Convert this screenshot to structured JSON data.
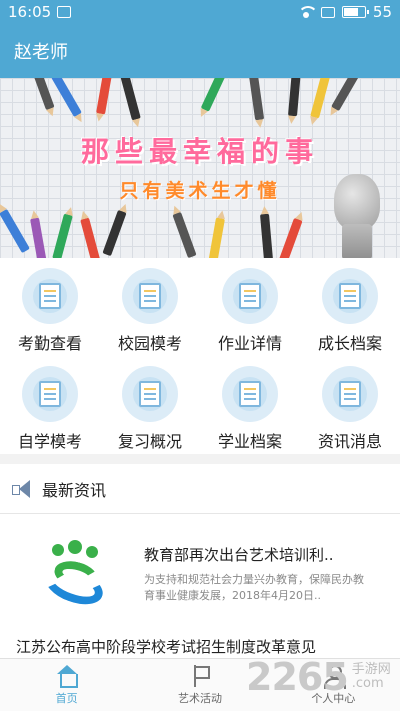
{
  "status_bar": {
    "time": "16:05",
    "battery": "55"
  },
  "header": {
    "title": "赵老师"
  },
  "banner": {
    "title": "那些最幸福的事",
    "subtitle": "只有美术生才懂"
  },
  "grid": [
    {
      "label": "考勤查看",
      "icon": "attendance-calendar-icon"
    },
    {
      "label": "校园模考",
      "icon": "campus-exam-icon"
    },
    {
      "label": "作业详情",
      "icon": "homework-book-icon"
    },
    {
      "label": "成长档案",
      "icon": "growth-archive-icon"
    },
    {
      "label": "自学模考",
      "icon": "self-study-icon"
    },
    {
      "label": "复习概况",
      "icon": "review-icon"
    },
    {
      "label": "学业档案",
      "icon": "academic-folder-icon"
    },
    {
      "label": "资讯消息",
      "icon": "news-message-icon"
    }
  ],
  "news": {
    "header": "最新资讯",
    "items": [
      {
        "title": "教育部再次出台艺术培训利..",
        "summary": "为支持和规范社会力量兴办教育，保障民办教育事业健康发展，2018年4月20日.."
      },
      {
        "title": "江苏公布高中阶段学校考试招生制度改革意见"
      }
    ]
  },
  "bottom_nav": [
    {
      "label": "首页",
      "active": true
    },
    {
      "label": "艺术活动",
      "active": false
    },
    {
      "label": "个人中心",
      "active": false
    }
  ],
  "watermark": {
    "number": "2265",
    "line1": "手游网",
    "line2": ".com"
  },
  "colors": {
    "primary": "#4fa8d3",
    "banner_title": "#ff6a9c",
    "banner_subtitle": "#ff8a2b"
  }
}
